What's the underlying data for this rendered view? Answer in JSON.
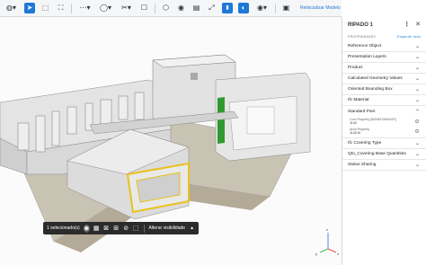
{
  "toolbar": {
    "tools": [
      {
        "name": "navigate-icon",
        "glyph": "◍▾"
      },
      {
        "name": "select-pointer-icon",
        "glyph": "➤"
      },
      {
        "name": "box-select-icon",
        "glyph": "⬚"
      },
      {
        "name": "frame-icon",
        "glyph": "⛶"
      },
      {
        "name": "measure-icon",
        "glyph": "⋯▾"
      },
      {
        "name": "section-ellipse-icon",
        "glyph": "◯▾"
      },
      {
        "name": "clip-tool-icon",
        "glyph": "✂▾"
      },
      {
        "name": "annotation-icon",
        "glyph": "☐"
      },
      {
        "name": "cube-icon",
        "glyph": "⬡"
      },
      {
        "name": "camera-icon",
        "glyph": "◉"
      },
      {
        "name": "document-icon",
        "glyph": "▤"
      },
      {
        "name": "fit-icon",
        "glyph": "⤢"
      },
      {
        "name": "lock-icon",
        "glyph": "🔒"
      },
      {
        "name": "visibility-icon",
        "glyph": "◐"
      },
      {
        "name": "eye-icon",
        "glyph": "◉▾"
      },
      {
        "name": "save-icon",
        "glyph": "▣"
      }
    ],
    "reset_label": "Reinicializar Modelo"
  },
  "selection_bar": {
    "count_label": "1 selecionado(s)",
    "action_label": "Alterar visibilidade",
    "icons": [
      {
        "name": "isolate-icon",
        "glyph": "◉"
      },
      {
        "name": "hide-icon",
        "glyph": "▦"
      },
      {
        "name": "fit-selection-icon",
        "glyph": "⊠"
      },
      {
        "name": "show-all-icon",
        "glyph": "⊞"
      },
      {
        "name": "hide-eye-icon",
        "glyph": "⊘"
      },
      {
        "name": "ghost-icon",
        "glyph": "⬚"
      }
    ]
  },
  "panel": {
    "title": "RIPADO 1",
    "more_glyph": "⋮",
    "close_glyph": "✕",
    "properties_label": "PROPRIEDADES",
    "expand_all_label": "Expandir tudo",
    "sections": [
      {
        "label": "Reference Object",
        "open": false
      },
      {
        "label": "Presentation Layers",
        "open": false
      },
      {
        "label": "Product",
        "open": false
      },
      {
        "label": "Calculated Geometry Values",
        "open": false
      },
      {
        "label": "Oriented Bounding Box",
        "open": false
      },
      {
        "label": "Ifc Material",
        "open": false
      },
      {
        "label": "Standard Pset",
        "open": true
      }
    ],
    "standard_pset_props": [
      {
        "name": "Com Property [M2NDITAMUNIT]",
        "value": "1140"
      },
      {
        "name": "Area Property",
        "value": "1140 M"
      }
    ],
    "sections_after": [
      {
        "label": "Ifc Covering Type",
        "open": false
      },
      {
        "label": "Qto_Covering Base Quantities",
        "open": false
      },
      {
        "label": "Status Sharing",
        "open": false
      }
    ],
    "chevron_closed": "⌄",
    "chevron_open": "⌃"
  },
  "colors": {
    "accent": "#1e78d7",
    "selection": "#e8c21e",
    "highlight_green": "#2f9a2f",
    "selection_bar_bg": "#2b2b2b"
  },
  "axis": {
    "x": "x",
    "y": "y",
    "z": "z"
  }
}
